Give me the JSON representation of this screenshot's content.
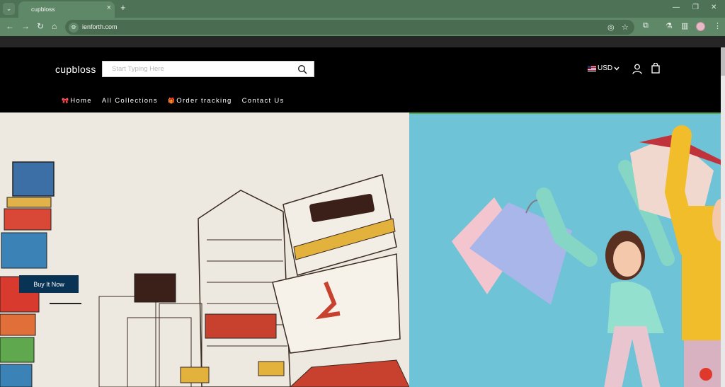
{
  "browser": {
    "tab_title": "cupbloss",
    "url": "ienforth.com",
    "new_tab_symbol": "+",
    "tab_close_symbol": "×",
    "window_controls": [
      "—",
      "❐",
      "✕"
    ]
  },
  "site": {
    "logo": "cupbloss",
    "search": {
      "placeholder": "Start Typing Here",
      "value": ""
    },
    "currency": "USD",
    "nav": [
      {
        "icon": "🎀",
        "label": "Home"
      },
      {
        "icon": "",
        "label": "All Collections"
      },
      {
        "icon": "🎁",
        "label": "Order tracking"
      },
      {
        "icon": "",
        "label": "Contact Us"
      }
    ]
  },
  "hero": {
    "cta_label": "Buy It Now"
  },
  "colors": {
    "chrome_tab": "#4e7256",
    "chrome_toolbar": "#5f8868",
    "header_bg": "#000000",
    "cta_bg": "#083355",
    "hero_right_bg": "#6fc3d6"
  }
}
